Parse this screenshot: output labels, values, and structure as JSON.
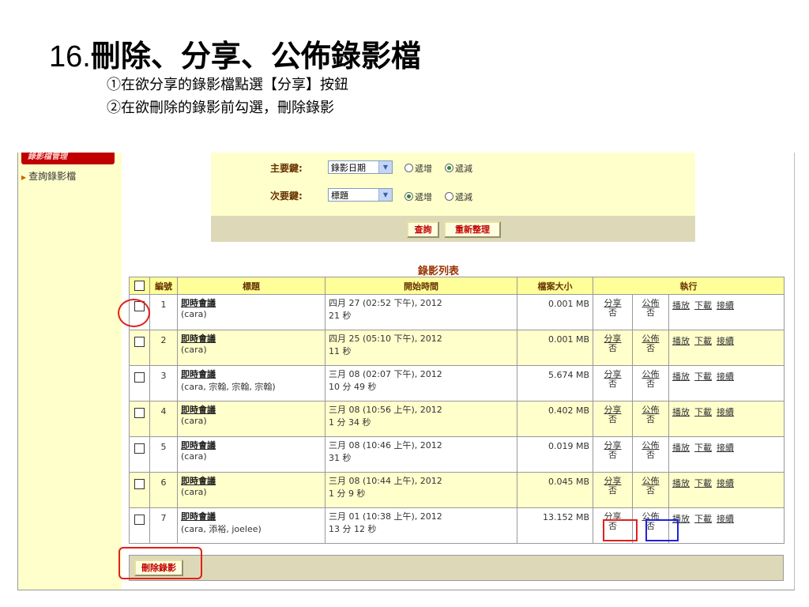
{
  "slide": {
    "title_num": "16.",
    "title_rest": "刪除、分享、公佈錄影檔",
    "instruction_1": "①在欲分享的錄影檔點選【分享】按鈕",
    "instruction_2": "②在欲刪除的錄影前勾選，刪除錄影"
  },
  "sidebar": {
    "header": "錄影檔管理",
    "items": [
      {
        "label": "查詢錄影檔"
      }
    ]
  },
  "query": {
    "primary_label": "主要鍵:",
    "primary_value": "錄影日期",
    "primary_asc": "遞增",
    "primary_desc": "遞減",
    "primary_selected": "desc",
    "secondary_label": "次要鍵:",
    "secondary_value": "標題",
    "secondary_asc": "遞增",
    "secondary_desc": "遞減",
    "secondary_selected": "asc",
    "search_btn": "查詢",
    "reset_btn": "重新整理"
  },
  "list": {
    "title": "錄影列表",
    "headers": {
      "no": "編號",
      "title": "標題",
      "start": "開始時間",
      "size": "檔案大小",
      "actions": "執行"
    },
    "rows": [
      {
        "no": "1",
        "title": "即時會議",
        "participants": "(cara)",
        "start": "四月 27 (02:52 下午), 2012",
        "duration": "21 秒",
        "size": "0.001 MB",
        "share": "分享",
        "share_state": "否",
        "publish": "公佈",
        "publish_state": "否",
        "play": "播放",
        "download": "下載",
        "continue": "接續"
      },
      {
        "no": "2",
        "title": "即時會議",
        "participants": "(cara)",
        "start": "四月 25 (05:10 下午), 2012",
        "duration": "11 秒",
        "size": "0.001 MB",
        "share": "分享",
        "share_state": "否",
        "publish": "公佈",
        "publish_state": "否",
        "play": "播放",
        "download": "下載",
        "continue": "接續"
      },
      {
        "no": "3",
        "title": "即時會議",
        "participants": "(cara, 宗翰, 宗翰, 宗翰)",
        "start": "三月 08 (02:07 下午), 2012",
        "duration": "10 分 49 秒",
        "size": "5.674 MB",
        "share": "分享",
        "share_state": "否",
        "publish": "公佈",
        "publish_state": "否",
        "play": "播放",
        "download": "下載",
        "continue": "接續"
      },
      {
        "no": "4",
        "title": "即時會議",
        "participants": "(cara)",
        "start": "三月 08 (10:56 上午), 2012",
        "duration": "1 分 34 秒",
        "size": "0.402 MB",
        "share": "分享",
        "share_state": "否",
        "publish": "公佈",
        "publish_state": "否",
        "play": "播放",
        "download": "下載",
        "continue": "接續"
      },
      {
        "no": "5",
        "title": "即時會議",
        "participants": "(cara)",
        "start": "三月 08 (10:46 上午), 2012",
        "duration": "31 秒",
        "size": "0.019 MB",
        "share": "分享",
        "share_state": "否",
        "publish": "公佈",
        "publish_state": "否",
        "play": "播放",
        "download": "下載",
        "continue": "接續"
      },
      {
        "no": "6",
        "title": "即時會議",
        "participants": "(cara)",
        "start": "三月 08 (10:44 上午), 2012",
        "duration": "1 分 9 秒",
        "size": "0.045 MB",
        "share": "分享",
        "share_state": "否",
        "publish": "公佈",
        "publish_state": "否",
        "play": "播放",
        "download": "下載",
        "continue": "接續"
      },
      {
        "no": "7",
        "title": "即時會議",
        "participants": "(cara, 添裕, joelee)",
        "start": "三月 01 (10:38 上午), 2012",
        "duration": "13 分 12 秒",
        "size": "13.152 MB",
        "share": "分享",
        "share_state": "否",
        "publish": "公佈",
        "publish_state": "否",
        "play": "播放",
        "download": "下載",
        "continue": "接續"
      }
    ],
    "delete_btn": "刪除錄影"
  },
  "colors": {
    "highlight_red": "#e02020",
    "highlight_blue": "#2020e0",
    "panel_yellow": "#ffffcc"
  }
}
